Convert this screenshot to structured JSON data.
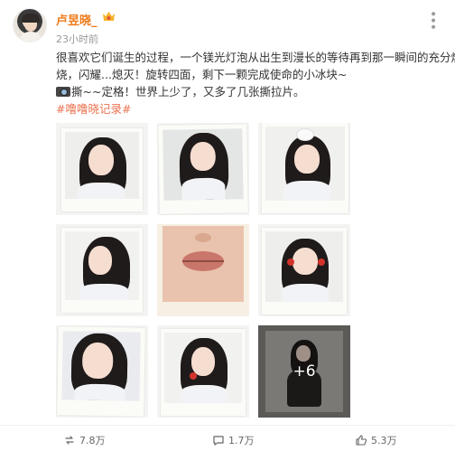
{
  "post": {
    "username": "卢昱晓_",
    "time": "23小时前",
    "text_line1": "很喜欢它们诞生的过程，一个镁光灯泡从出生到漫长的等待再到那一瞬间的充分燃",
    "text_line2": "烧，闪耀...熄灭！旋转四面，剩下一颗完成使命的小冰块~",
    "text_line3": "撕~~定格！世界上少了，又多了几张撕拉片。",
    "hashtag": "#噜噜晓记录#",
    "more_photos": "+6"
  },
  "actions": {
    "repost": "7.8万",
    "comment": "1.7万",
    "like": "5.3万"
  },
  "colors": {
    "username": "#f07a18",
    "hashtag": "#eb7350"
  }
}
